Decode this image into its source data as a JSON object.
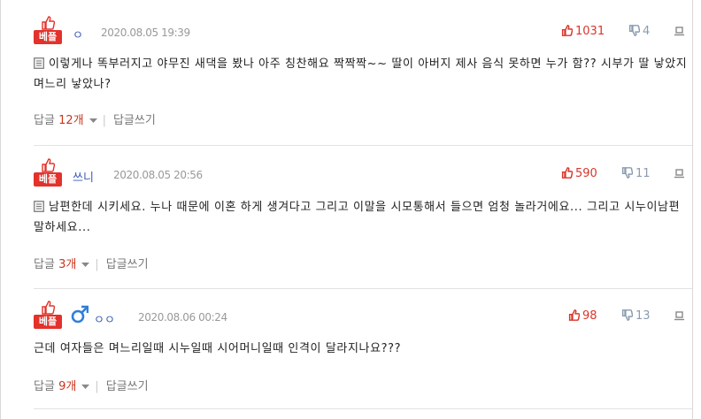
{
  "colors": {
    "accent": "#e3322b",
    "nick": "#3a5bb8",
    "like": "#d9352b",
    "dislike": "#8a9bb0"
  },
  "comments": [
    {
      "badge": "베플",
      "nickname": "ㅇ",
      "timestamp": "2020.08.05 19:39",
      "likes": "1031",
      "dislikes": "4",
      "text": "이렇게나 똑부러지고 야무진 새댁을 봤나 아주 칭찬해요 짝짝짝~~ 딸이 아버지 제사 음식 못하면 누가 함?? 시부가 딸 낳았지 며느리 낳았나?",
      "reply_label": "답글",
      "reply_count": "12개",
      "write_label": "답글쓰기"
    },
    {
      "badge": "베플",
      "nickname": "쓰니",
      "timestamp": "2020.08.05 20:56",
      "likes": "590",
      "dislikes": "11",
      "text": "남편한데 시키세요. 누나 때문에 이혼 하게 생겨다고 그리고 이말을 시모통해서 들으면 엄청 놀라거에요... 그리고 시누이남편 말하세요...",
      "reply_label": "답글",
      "reply_count": "3개",
      "write_label": "답글쓰기"
    },
    {
      "badge": "베플",
      "nickname": "ㅇㅇ",
      "timestamp": "2020.08.06 00:24",
      "likes": "98",
      "dislikes": "13",
      "text": "근데 여자들은 며느리일때 시누일때 시어머니일때 인격이 달라지나요???",
      "reply_label": "답글",
      "reply_count": "9개",
      "write_label": "답글쓰기"
    }
  ]
}
